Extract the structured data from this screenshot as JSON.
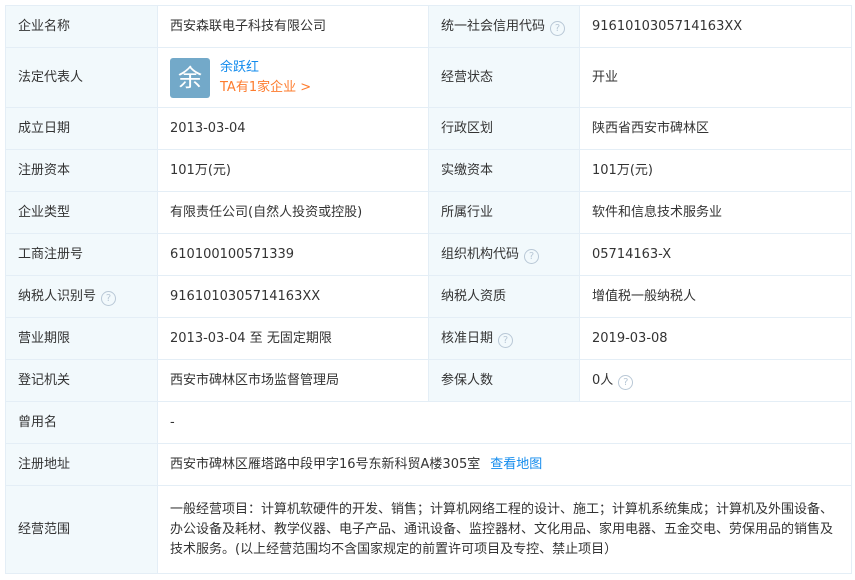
{
  "rows": {
    "r1": {
      "l1": "企业名称",
      "v1": "西安森联电子科技有限公司",
      "l2": "统一社会信用代码",
      "v2": "9161010305714163XX"
    },
    "r2": {
      "l1": "法定代表人",
      "avatar_char": "余",
      "rep_name": "余跃红",
      "rep_link": "TA有1家企业 >",
      "l2": "经营状态",
      "v2": "开业"
    },
    "r3": {
      "l1": "成立日期",
      "v1": "2013-03-04",
      "l2": "行政区划",
      "v2": "陕西省西安市碑林区"
    },
    "r4": {
      "l1": "注册资本",
      "v1": "101万(元)",
      "l2": "实缴资本",
      "v2": "101万(元)"
    },
    "r5": {
      "l1": "企业类型",
      "v1": "有限责任公司(自然人投资或控股)",
      "l2": "所属行业",
      "v2": "软件和信息技术服务业"
    },
    "r6": {
      "l1": "工商注册号",
      "v1": "610100100571339",
      "l2": "组织机构代码",
      "v2": "05714163-X"
    },
    "r7": {
      "l1": "纳税人识别号",
      "v1": "9161010305714163XX",
      "l2": "纳税人资质",
      "v2": "增值税一般纳税人"
    },
    "r8": {
      "l1": "营业期限",
      "v1": "2013-03-04 至 无固定期限",
      "l2": "核准日期",
      "v2": "2019-03-08"
    },
    "r9": {
      "l1": "登记机关",
      "v1": "西安市碑林区市场监督管理局",
      "l2": "参保人数",
      "v2": "0人"
    },
    "r10": {
      "l1": "曾用名",
      "v1": "-"
    },
    "r11": {
      "l1": "注册地址",
      "v1": "西安市碑林区雁塔路中段甲字16号东新科贸A楼305室",
      "map_link": "查看地图"
    },
    "r12": {
      "l1": "经营范围",
      "v1": "一般经营项目：计算机软硬件的开发、销售；计算机网络工程的设计、施工；计算机系统集成；计算机及外围设备、办公设备及耗材、教学仪器、电子产品、通讯设备、监控器材、文化用品、家用电器、五金交电、劳保用品的销售及技术服务。(以上经营范围均不含国家规定的前置许可项目及专控、禁止项目）"
    }
  },
  "help_glyph": "?",
  "colors": {
    "label_bg": "#f2f9fc",
    "border": "#e4eef6",
    "link_blue": "#128bed",
    "link_orange": "#fd7c2e",
    "avatar_bg": "#73a9c9"
  }
}
